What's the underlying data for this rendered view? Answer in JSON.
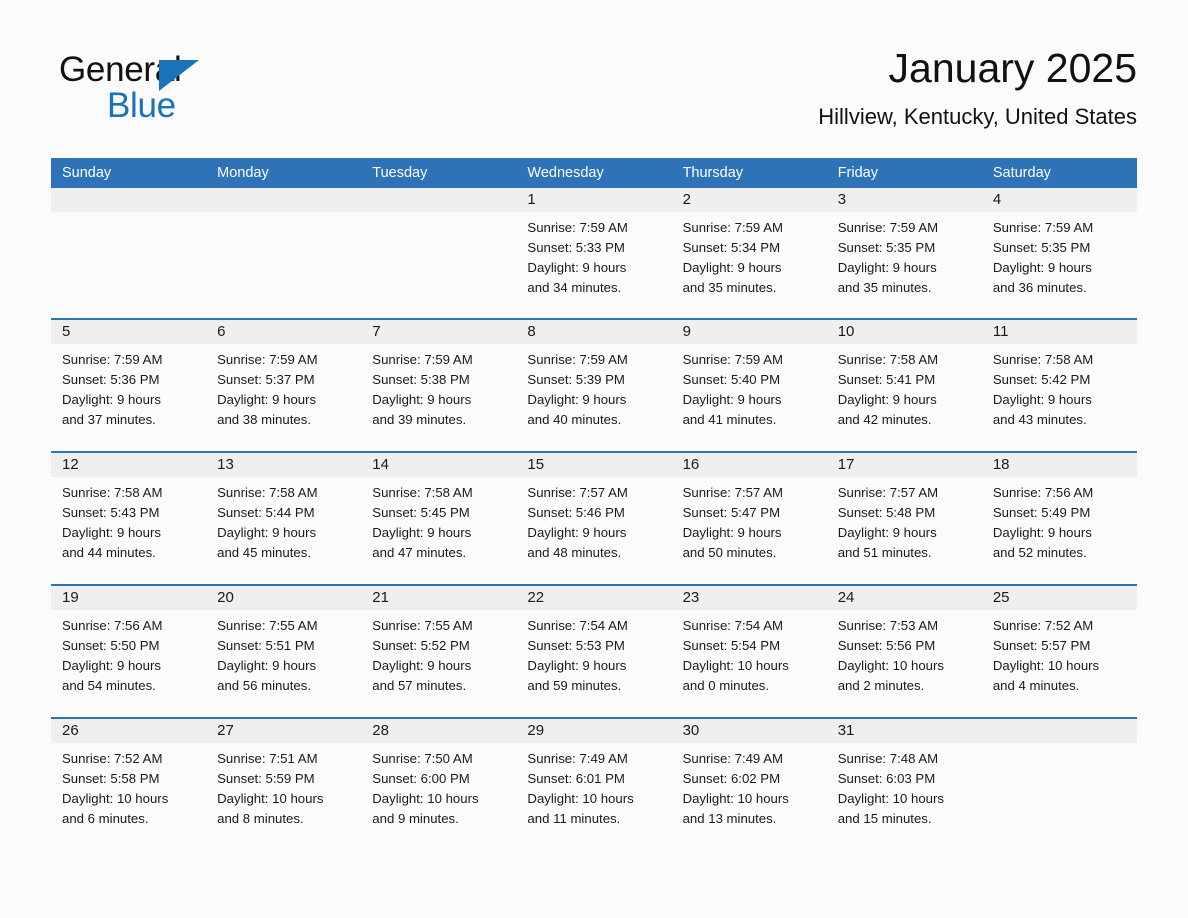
{
  "brand": {
    "name_part1": "General",
    "name_part2": "Blue",
    "logo_icon": "triangle-logo-icon",
    "accent_color": "#1a73b8"
  },
  "header": {
    "title": "January 2025",
    "location": "Hillview, Kentucky, United States"
  },
  "theme": {
    "header_blue": "#2e72b8",
    "day_band_gray": "#efefef",
    "page_background": "#fbfbfb",
    "text_color": "#1a1a1a"
  },
  "calendar": {
    "weekday_headers": [
      "Sunday",
      "Monday",
      "Tuesday",
      "Wednesday",
      "Thursday",
      "Friday",
      "Saturday"
    ],
    "weeks": [
      [
        {
          "day": "",
          "sunrise": "",
          "sunset": "",
          "daylight_line1": "",
          "daylight_line2": "",
          "empty": true
        },
        {
          "day": "",
          "sunrise": "",
          "sunset": "",
          "daylight_line1": "",
          "daylight_line2": "",
          "empty": true
        },
        {
          "day": "",
          "sunrise": "",
          "sunset": "",
          "daylight_line1": "",
          "daylight_line2": "",
          "empty": true
        },
        {
          "day": "1",
          "sunrise": "Sunrise: 7:59 AM",
          "sunset": "Sunset: 5:33 PM",
          "daylight_line1": "Daylight: 9 hours",
          "daylight_line2": "and 34 minutes.",
          "empty": false
        },
        {
          "day": "2",
          "sunrise": "Sunrise: 7:59 AM",
          "sunset": "Sunset: 5:34 PM",
          "daylight_line1": "Daylight: 9 hours",
          "daylight_line2": "and 35 minutes.",
          "empty": false
        },
        {
          "day": "3",
          "sunrise": "Sunrise: 7:59 AM",
          "sunset": "Sunset: 5:35 PM",
          "daylight_line1": "Daylight: 9 hours",
          "daylight_line2": "and 35 minutes.",
          "empty": false
        },
        {
          "day": "4",
          "sunrise": "Sunrise: 7:59 AM",
          "sunset": "Sunset: 5:35 PM",
          "daylight_line1": "Daylight: 9 hours",
          "daylight_line2": "and 36 minutes.",
          "empty": false
        }
      ],
      [
        {
          "day": "5",
          "sunrise": "Sunrise: 7:59 AM",
          "sunset": "Sunset: 5:36 PM",
          "daylight_line1": "Daylight: 9 hours",
          "daylight_line2": "and 37 minutes.",
          "empty": false
        },
        {
          "day": "6",
          "sunrise": "Sunrise: 7:59 AM",
          "sunset": "Sunset: 5:37 PM",
          "daylight_line1": "Daylight: 9 hours",
          "daylight_line2": "and 38 minutes.",
          "empty": false
        },
        {
          "day": "7",
          "sunrise": "Sunrise: 7:59 AM",
          "sunset": "Sunset: 5:38 PM",
          "daylight_line1": "Daylight: 9 hours",
          "daylight_line2": "and 39 minutes.",
          "empty": false
        },
        {
          "day": "8",
          "sunrise": "Sunrise: 7:59 AM",
          "sunset": "Sunset: 5:39 PM",
          "daylight_line1": "Daylight: 9 hours",
          "daylight_line2": "and 40 minutes.",
          "empty": false
        },
        {
          "day": "9",
          "sunrise": "Sunrise: 7:59 AM",
          "sunset": "Sunset: 5:40 PM",
          "daylight_line1": "Daylight: 9 hours",
          "daylight_line2": "and 41 minutes.",
          "empty": false
        },
        {
          "day": "10",
          "sunrise": "Sunrise: 7:58 AM",
          "sunset": "Sunset: 5:41 PM",
          "daylight_line1": "Daylight: 9 hours",
          "daylight_line2": "and 42 minutes.",
          "empty": false
        },
        {
          "day": "11",
          "sunrise": "Sunrise: 7:58 AM",
          "sunset": "Sunset: 5:42 PM",
          "daylight_line1": "Daylight: 9 hours",
          "daylight_line2": "and 43 minutes.",
          "empty": false
        }
      ],
      [
        {
          "day": "12",
          "sunrise": "Sunrise: 7:58 AM",
          "sunset": "Sunset: 5:43 PM",
          "daylight_line1": "Daylight: 9 hours",
          "daylight_line2": "and 44 minutes.",
          "empty": false
        },
        {
          "day": "13",
          "sunrise": "Sunrise: 7:58 AM",
          "sunset": "Sunset: 5:44 PM",
          "daylight_line1": "Daylight: 9 hours",
          "daylight_line2": "and 45 minutes.",
          "empty": false
        },
        {
          "day": "14",
          "sunrise": "Sunrise: 7:58 AM",
          "sunset": "Sunset: 5:45 PM",
          "daylight_line1": "Daylight: 9 hours",
          "daylight_line2": "and 47 minutes.",
          "empty": false
        },
        {
          "day": "15",
          "sunrise": "Sunrise: 7:57 AM",
          "sunset": "Sunset: 5:46 PM",
          "daylight_line1": "Daylight: 9 hours",
          "daylight_line2": "and 48 minutes.",
          "empty": false
        },
        {
          "day": "16",
          "sunrise": "Sunrise: 7:57 AM",
          "sunset": "Sunset: 5:47 PM",
          "daylight_line1": "Daylight: 9 hours",
          "daylight_line2": "and 50 minutes.",
          "empty": false
        },
        {
          "day": "17",
          "sunrise": "Sunrise: 7:57 AM",
          "sunset": "Sunset: 5:48 PM",
          "daylight_line1": "Daylight: 9 hours",
          "daylight_line2": "and 51 minutes.",
          "empty": false
        },
        {
          "day": "18",
          "sunrise": "Sunrise: 7:56 AM",
          "sunset": "Sunset: 5:49 PM",
          "daylight_line1": "Daylight: 9 hours",
          "daylight_line2": "and 52 minutes.",
          "empty": false
        }
      ],
      [
        {
          "day": "19",
          "sunrise": "Sunrise: 7:56 AM",
          "sunset": "Sunset: 5:50 PM",
          "daylight_line1": "Daylight: 9 hours",
          "daylight_line2": "and 54 minutes.",
          "empty": false
        },
        {
          "day": "20",
          "sunrise": "Sunrise: 7:55 AM",
          "sunset": "Sunset: 5:51 PM",
          "daylight_line1": "Daylight: 9 hours",
          "daylight_line2": "and 56 minutes.",
          "empty": false
        },
        {
          "day": "21",
          "sunrise": "Sunrise: 7:55 AM",
          "sunset": "Sunset: 5:52 PM",
          "daylight_line1": "Daylight: 9 hours",
          "daylight_line2": "and 57 minutes.",
          "empty": false
        },
        {
          "day": "22",
          "sunrise": "Sunrise: 7:54 AM",
          "sunset": "Sunset: 5:53 PM",
          "daylight_line1": "Daylight: 9 hours",
          "daylight_line2": "and 59 minutes.",
          "empty": false
        },
        {
          "day": "23",
          "sunrise": "Sunrise: 7:54 AM",
          "sunset": "Sunset: 5:54 PM",
          "daylight_line1": "Daylight: 10 hours",
          "daylight_line2": "and 0 minutes.",
          "empty": false
        },
        {
          "day": "24",
          "sunrise": "Sunrise: 7:53 AM",
          "sunset": "Sunset: 5:56 PM",
          "daylight_line1": "Daylight: 10 hours",
          "daylight_line2": "and 2 minutes.",
          "empty": false
        },
        {
          "day": "25",
          "sunrise": "Sunrise: 7:52 AM",
          "sunset": "Sunset: 5:57 PM",
          "daylight_line1": "Daylight: 10 hours",
          "daylight_line2": "and 4 minutes.",
          "empty": false
        }
      ],
      [
        {
          "day": "26",
          "sunrise": "Sunrise: 7:52 AM",
          "sunset": "Sunset: 5:58 PM",
          "daylight_line1": "Daylight: 10 hours",
          "daylight_line2": "and 6 minutes.",
          "empty": false
        },
        {
          "day": "27",
          "sunrise": "Sunrise: 7:51 AM",
          "sunset": "Sunset: 5:59 PM",
          "daylight_line1": "Daylight: 10 hours",
          "daylight_line2": "and 8 minutes.",
          "empty": false
        },
        {
          "day": "28",
          "sunrise": "Sunrise: 7:50 AM",
          "sunset": "Sunset: 6:00 PM",
          "daylight_line1": "Daylight: 10 hours",
          "daylight_line2": "and 9 minutes.",
          "empty": false
        },
        {
          "day": "29",
          "sunrise": "Sunrise: 7:49 AM",
          "sunset": "Sunset: 6:01 PM",
          "daylight_line1": "Daylight: 10 hours",
          "daylight_line2": "and 11 minutes.",
          "empty": false
        },
        {
          "day": "30",
          "sunrise": "Sunrise: 7:49 AM",
          "sunset": "Sunset: 6:02 PM",
          "daylight_line1": "Daylight: 10 hours",
          "daylight_line2": "and 13 minutes.",
          "empty": false
        },
        {
          "day": "31",
          "sunrise": "Sunrise: 7:48 AM",
          "sunset": "Sunset: 6:03 PM",
          "daylight_line1": "Daylight: 10 hours",
          "daylight_line2": "and 15 minutes.",
          "empty": false
        },
        {
          "day": "",
          "sunrise": "",
          "sunset": "",
          "daylight_line1": "",
          "daylight_line2": "",
          "empty": true
        }
      ]
    ]
  }
}
